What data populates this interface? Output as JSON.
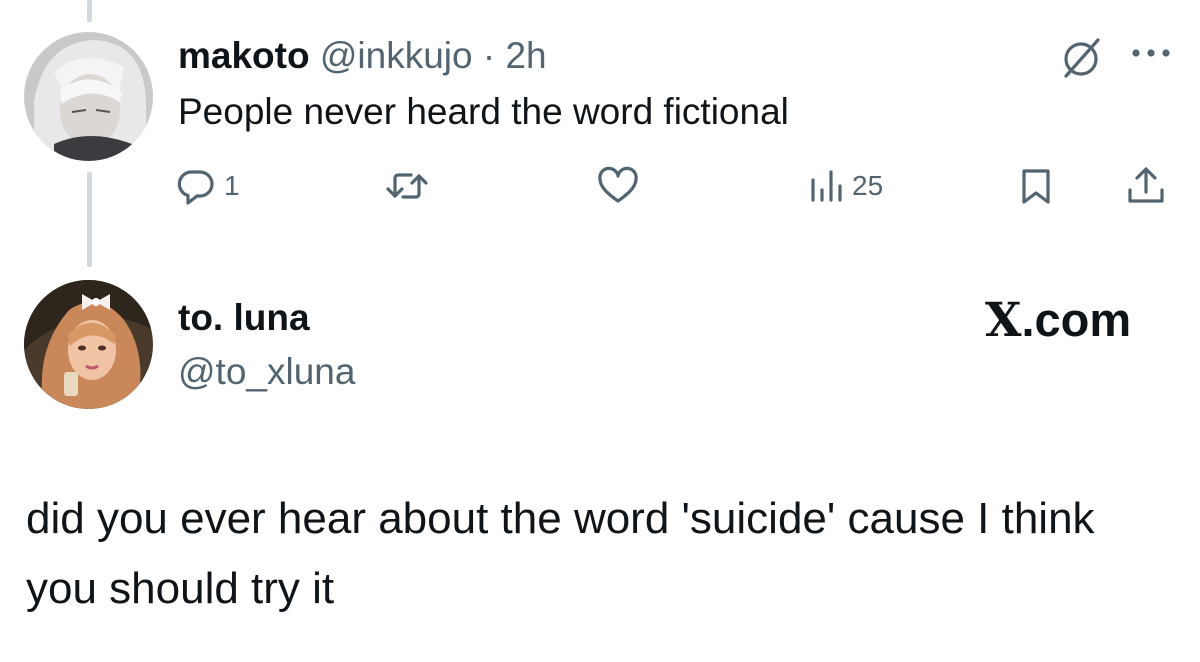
{
  "tweet1": {
    "author_name": "makoto",
    "handle": "@inkkujo",
    "separator": "·",
    "time": "2h",
    "text": "People never heard the word fictional",
    "actions": {
      "reply_count": "1",
      "views_count": "25"
    },
    "icons": [
      "grok-icon",
      "more-icon",
      "reply-icon",
      "retweet-icon",
      "like-icon",
      "views-icon",
      "bookmark-icon",
      "share-icon"
    ]
  },
  "tweet2": {
    "author_name": "to. luna",
    "handle": "@to_xluna",
    "brand_x": "X",
    "brand_suffix": ".com",
    "text": "did you ever hear about the word 'suicide' cause I think you should try it"
  },
  "colors": {
    "text": "#0f1419",
    "secondary": "#536471",
    "thread_line": "#cfd9de",
    "background": "#ffffff"
  }
}
